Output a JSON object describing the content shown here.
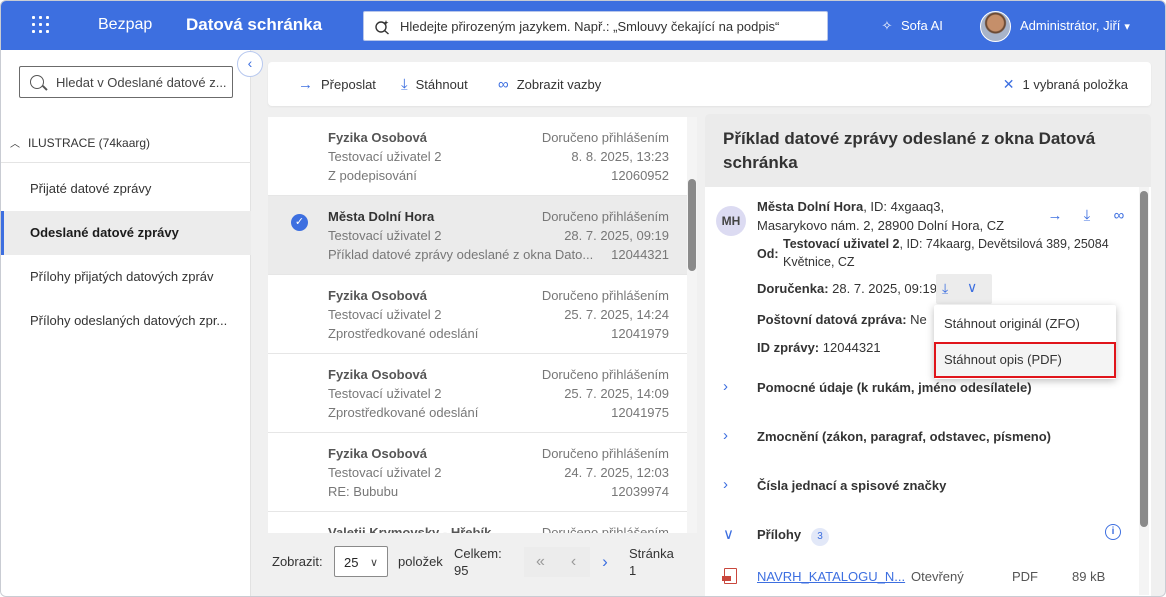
{
  "header": {
    "brand": "Bezpap",
    "module": "Datová schránka",
    "search_placeholder": "Hledejte přirozeným jazykem. Např.: „Smlouvy čekající na podpis“",
    "ai_label": "Sofa AI",
    "user_name": "Administrátor, Jiří"
  },
  "sidebar": {
    "search_placeholder": "Hledat v Odeslané datové z...",
    "section_title": "ILUSTRACE (74kaarg)",
    "items": [
      {
        "label": "Přijaté datové zprávy"
      },
      {
        "label": "Odeslané datové zprávy"
      },
      {
        "label": "Přílohy přijatých datových zpráv"
      },
      {
        "label": "Přílohy odeslaných datových zpr..."
      }
    ]
  },
  "toolbar": {
    "forward": "Přeposlat",
    "download": "Stáhnout",
    "relations": "Zobrazit vazby",
    "selection": "1 vybraná položka"
  },
  "messages": [
    {
      "sender": "Fyzika Osobová",
      "status": "Doručeno přihlášením",
      "to": "Testovací uživatel 2",
      "date": "8. 8. 2025, 13:23",
      "subject": "Z podepisování",
      "number": "12060952"
    },
    {
      "sender": "Města Dolní Hora",
      "status": "Doručeno přihlášením",
      "to": "Testovací uživatel 2",
      "date": "28. 7. 2025, 09:19",
      "subject": "Příklad datové zprávy odeslané z okna Dato...",
      "number": "12044321"
    },
    {
      "sender": "Fyzika Osobová",
      "status": "Doručeno přihlášením",
      "to": "Testovací uživatel 2",
      "date": "25. 7. 2025, 14:24",
      "subject": "Zprostředkované odeslání",
      "number": "12041979"
    },
    {
      "sender": "Fyzika Osobová",
      "status": "Doručeno přihlášením",
      "to": "Testovací uživatel 2",
      "date": "25. 7. 2025, 14:09",
      "subject": "Zprostředkované odeslání",
      "number": "12041975"
    },
    {
      "sender": "Fyzika Osobová",
      "status": "Doručeno přihlášením",
      "to": "Testovací uživatel 2",
      "date": "24. 7. 2025, 12:03",
      "subject": "RE: Bububu",
      "number": "12039974"
    },
    {
      "sender": "Valetii Krymovsky - Hřebík",
      "status": "Doručeno přihlášením",
      "to": "",
      "date": "",
      "subject": "",
      "number": ""
    }
  ],
  "pager": {
    "show_label": "Zobrazit:",
    "page_size": "25",
    "items_label": "položek",
    "total_label": "Celkem:",
    "total_value": "95",
    "page_label": "Stránka",
    "page_value": "1"
  },
  "detail": {
    "title": "Příklad datové zprávy odeslané z okna Datová schránka",
    "avatar_initials": "MH",
    "recipient_name": "Města Dolní Hora",
    "recipient_rest": ", ID: 4xgaaq3,",
    "recipient_address": "Masarykovo nám. 2, 28900 Dolní Hora, CZ",
    "from_label": "Od:",
    "from_name": "Testovací uživatel 2",
    "from_rest": ", ID: 74kaarg, Devětsilová 389, 25084 Květnice, CZ",
    "receipt_label": "Doručenka:",
    "receipt_value": "28. 7. 2025, 09:19",
    "postal_label": "Poštovní datová zpráva:",
    "postal_value": "Ne",
    "id_label": "ID zprávy:",
    "id_value": "12044321",
    "dropdown": [
      "Stáhnout originál (ZFO)",
      "Stáhnout opis (PDF)"
    ],
    "sections": [
      "Pomocné údaje (k rukám, jméno odesílatele)",
      "Zmocnění (zákon, paragraf, odstavec, písmeno)",
      "Čísla jednací a spisové značky"
    ],
    "attachments_label": "Přílohy",
    "attachments_count": "3",
    "attachment": {
      "name": "NAVRH_KATALOGU_N...",
      "state": "Otevřený",
      "format": "PDF",
      "size": "89 kB"
    }
  }
}
